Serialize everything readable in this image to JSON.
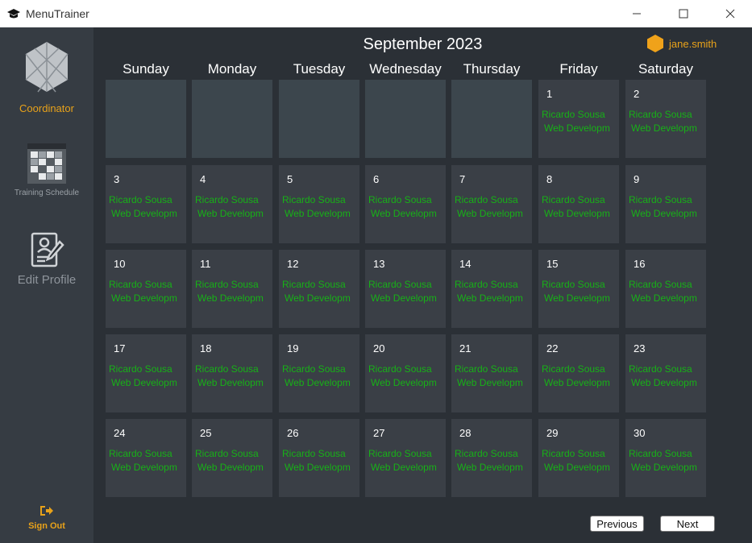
{
  "window": {
    "title": "MenuTrainer"
  },
  "sidebar": {
    "role_label": "Coordinator",
    "items": [
      {
        "label": "Training Schedule",
        "icon": "calendar-grid-icon"
      },
      {
        "label": "Edit Profile",
        "icon": "profile-edit-icon"
      }
    ],
    "signout_label": "Sign Out"
  },
  "header": {
    "month_title": "September 2023",
    "username": "jane.smith"
  },
  "weekdays": [
    "Sunday",
    "Monday",
    "Tuesday",
    "Wednesday",
    "Thursday",
    "Friday",
    "Saturday"
  ],
  "event": {
    "trainer": "Ricardo Sousa",
    "course": "Web Developm"
  },
  "days": [
    "1",
    "2",
    "3",
    "4",
    "5",
    "6",
    "7",
    "8",
    "9",
    "10",
    "11",
    "12",
    "13",
    "14",
    "15",
    "16",
    "17",
    "18",
    "19",
    "20",
    "21",
    "22",
    "23",
    "24",
    "25",
    "26",
    "27",
    "28",
    "29",
    "30"
  ],
  "nav": {
    "previous": "Previous",
    "next": "Next"
  },
  "colors": {
    "accent": "#e8a21a",
    "event_text": "#17b117",
    "background": "#2b3036",
    "sidebar": "#363c43"
  }
}
